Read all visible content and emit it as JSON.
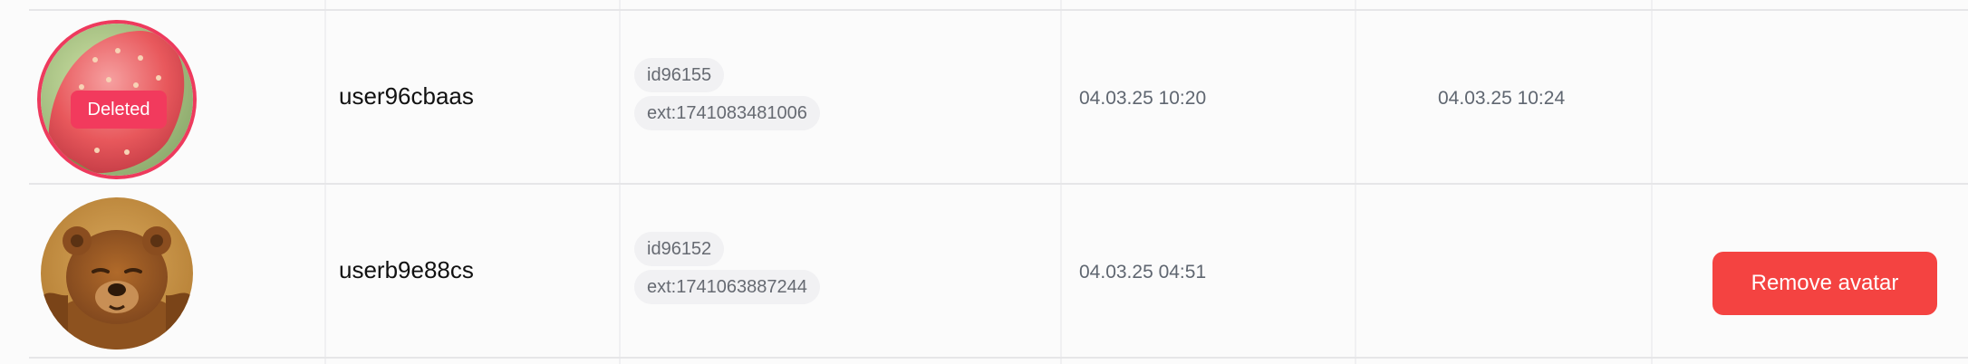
{
  "rows": [
    {
      "username": "user96cbaas",
      "badge": "Deleted",
      "id_tag": "id96155",
      "ext_tag": "ext:1741083481006",
      "date_1": "04.03.25 10:20",
      "date_2": "04.03.25 10:24",
      "avatar_icon": "strawberry-avatar-image"
    },
    {
      "username": "userb9e88cs",
      "id_tag": "id96152",
      "ext_tag": "ext:1741063887244",
      "date_1": "04.03.25 04:51",
      "date_2": "",
      "action_label": "Remove avatar",
      "avatar_icon": "bear-avatar-image"
    }
  ],
  "colors": {
    "danger": "#f44341",
    "deleted_badge": "#f23a5d",
    "tag_bg": "#f1f1f3"
  }
}
